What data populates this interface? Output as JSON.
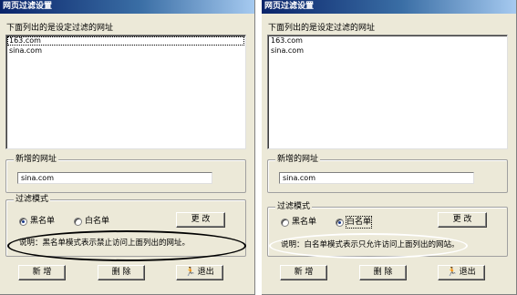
{
  "dialogs": [
    {
      "title": "网页过滤设置",
      "list_label": "下面列出的是设定过滤的网址",
      "list_items": [
        "163.com",
        "sina.com"
      ],
      "new_url_group_title": "新增的网址",
      "new_url_value": "sina.com",
      "filter_mode_group_title": "过滤模式",
      "radio_blacklist_label": "黑名单",
      "radio_whitelist_label": "白名单",
      "selected_mode": "blacklist",
      "change_button_label": "更 改",
      "note_text": "说明：黑名单模式表示禁止访问上面列出的网址。",
      "add_button_label": "新 增",
      "delete_button_label": "删 除",
      "exit_button_label": "退出",
      "exit_icon": "running-man-icon",
      "highlight_color": "#000000"
    },
    {
      "title": "网页过滤设置",
      "list_label": "下面列出的是设定过滤的网址",
      "list_items": [
        "163.com",
        "sina.com"
      ],
      "new_url_group_title": "新增的网址",
      "new_url_value": "sina.com",
      "filter_mode_group_title": "过滤模式",
      "radio_blacklist_label": "黑名单",
      "radio_whitelist_label": "白名单",
      "selected_mode": "whitelist",
      "change_button_label": "更 改",
      "note_text": "说明：白名单模式表示只允许访问上面列出的网站。",
      "add_button_label": "新 增",
      "delete_button_label": "删 除",
      "exit_button_label": "退出",
      "exit_icon": "running-man-icon",
      "highlight_color": "#ffffff"
    }
  ]
}
